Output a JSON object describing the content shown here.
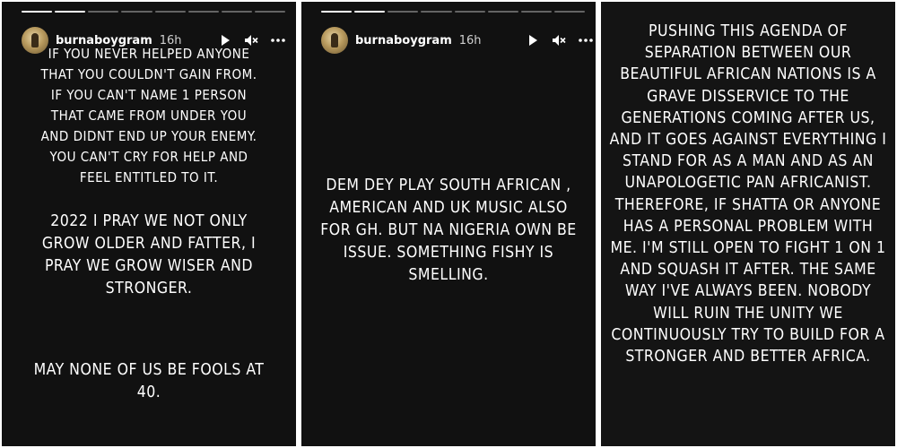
{
  "stories": [
    {
      "username": "burnaboygram",
      "time": "16h",
      "text_blocks": [
        "IF YOU NEVER HELPED ANYONE THAT YOU COULDN'T GAIN FROM. IF YOU CAN'T NAME 1 PERSON THAT CAME FROM UNDER YOU AND DIDNT END UP YOUR ENEMY. YOU CAN'T CRY FOR HELP AND FEEL ENTITLED TO IT.",
        "2022 I PRAY WE NOT ONLY GROW OLDER AND FATTER, I PRAY WE GROW WISER AND STRONGER.",
        "MAY NONE OF US BE FOOLS AT 40."
      ]
    },
    {
      "username": "burnaboygram",
      "time": "16h",
      "text_blocks": [
        "DEM DEY PLAY SOUTH AFRICAN , AMERICAN AND UK MUSIC ALSO FOR GH. BUT NA NIGERIA OWN BE ISSUE. SOMETHING FISHY IS SMELLING."
      ]
    },
    {
      "text_blocks": [
        "PUSHING THIS AGENDA OF SEPARATION BETWEEN OUR BEAUTIFUL AFRICAN NATIONS IS A GRAVE DISSERVICE TO THE GENERATIONS COMING AFTER US, AND IT GOES AGAINST EVERYTHING I STAND FOR AS A MAN AND AS AN UNAPOLOGETIC PAN AFRICANIST. THEREFORE, IF SHATTA OR ANYONE HAS A PERSONAL PROBLEM WITH ME. I'M STILL OPEN TO FIGHT 1 ON 1 AND SQUASH IT AFTER. THE SAME WAY I'VE ALWAYS BEEN. NOBODY WILL RUIN THE UNITY WE CONTINUOUSLY TRY TO BUILD FOR A STRONGER AND BETTER AFRICA."
      ]
    }
  ],
  "icons": {
    "play": "play-icon",
    "mute": "mute-icon",
    "more": "more-icon"
  },
  "colors": {
    "background": "#111111",
    "text": "#ffffff",
    "progress_active": "#ffffff",
    "progress_inactive": "rgba(255,255,255,0.35)"
  }
}
